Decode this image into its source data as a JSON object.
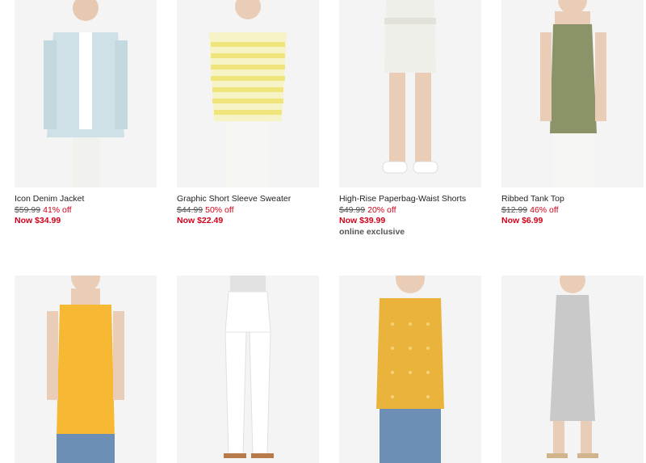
{
  "products": [
    {
      "name": "Icon Denim Jacket",
      "original_price": "$59.99",
      "discount": "41% off",
      "now_price": "Now $34.99",
      "badge": "",
      "color": "#cfe0e6"
    },
    {
      "name": "Graphic Short Sleeve Sweater",
      "original_price": "$44.99",
      "discount": "50% off",
      "now_price": "Now $22.49",
      "badge": "",
      "color": "#f3ec9a"
    },
    {
      "name": "High-Rise Paperbag-Waist Shorts",
      "original_price": "$49.99",
      "discount": "20% off",
      "now_price": "Now $39.99",
      "badge": "online exclusive",
      "color": "#efefe9"
    },
    {
      "name": "Ribbed Tank Top",
      "original_price": "$12.99",
      "discount": "46% off",
      "now_price": "Now $6.99",
      "badge": "",
      "color": "#8a9468"
    },
    {
      "name": "",
      "original_price": "",
      "discount": "",
      "now_price": "",
      "badge": "",
      "color": "#f7b833"
    },
    {
      "name": "",
      "original_price": "",
      "discount": "",
      "now_price": "",
      "badge": "",
      "color": "#f4f4f4"
    },
    {
      "name": "",
      "original_price": "",
      "discount": "",
      "now_price": "",
      "badge": "",
      "color": "#eab33b"
    },
    {
      "name": "",
      "original_price": "",
      "discount": "",
      "now_price": "",
      "badge": "",
      "color": "#c9c9c9"
    }
  ]
}
